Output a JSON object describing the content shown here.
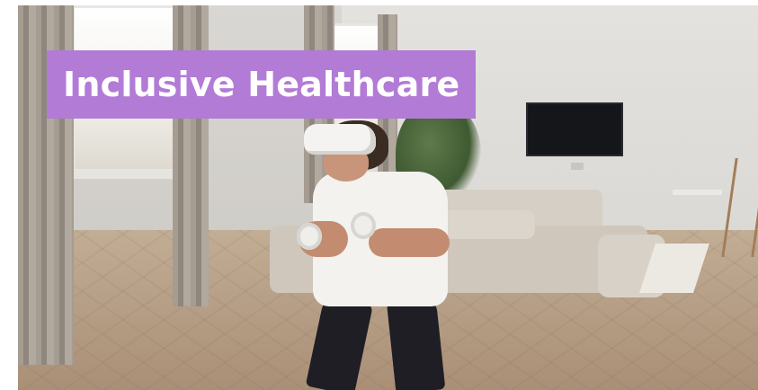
{
  "title": {
    "text": "Inclusive Healthcare",
    "background_color": "#b27bd6",
    "text_color": "#ffffff"
  },
  "photo": {
    "scene_elements": [
      "woman-wearing-vr-headset",
      "vr-controllers",
      "living-room",
      "sofa",
      "wall-tv",
      "curtains",
      "windows",
      "herringbone-floor",
      "plant"
    ]
  }
}
